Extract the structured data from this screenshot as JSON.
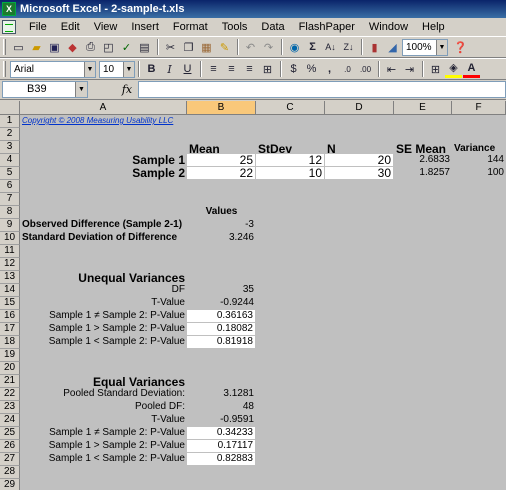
{
  "window": {
    "title": "Microsoft Excel - 2-sample-t.xls"
  },
  "menu": [
    "File",
    "Edit",
    "View",
    "Insert",
    "Format",
    "Tools",
    "Data",
    "FlashPaper",
    "Window",
    "Help"
  ],
  "toolbar": {
    "zoom": "100%",
    "font_name": "Arial",
    "font_size": "10"
  },
  "formula_bar": {
    "name_box": "B39",
    "fx": "fx",
    "formula": ""
  },
  "columns": [
    "A",
    "B",
    "C",
    "D",
    "E",
    "F"
  ],
  "active_column": "B",
  "rows": [
    "1",
    "2",
    "3",
    "4",
    "5",
    "6",
    "7",
    "8",
    "9",
    "10",
    "11",
    "12",
    "13",
    "14",
    "15",
    "16",
    "17",
    "18",
    "19",
    "20",
    "21",
    "22",
    "23",
    "24",
    "25",
    "26",
    "27",
    "28",
    "29"
  ],
  "sheet": {
    "copyright": "Copyright © 2008 Measuring Usability LLC",
    "headers": {
      "mean": "Mean",
      "stdev": "StDev",
      "n": "N",
      "se_mean": "SE Mean",
      "variance": "Variance"
    },
    "sample1": {
      "label": "Sample 1",
      "mean": "25",
      "stdev": "12",
      "n": "20",
      "se_mean": "2.6833",
      "variance": "144"
    },
    "sample2": {
      "label": "Sample 2",
      "mean": "22",
      "stdev": "10",
      "n": "30",
      "se_mean": "1.8257",
      "variance": "100"
    },
    "values_header": "Values",
    "observed_diff": {
      "label": "Observed Difference (Sample 2-1)",
      "value": "-3"
    },
    "sd_diff": {
      "label": "Standard Deviation of Difference",
      "value": "3.246"
    },
    "unequal": {
      "title": "Unequal Variances",
      "df": {
        "label": "DF",
        "value": "35"
      },
      "t": {
        "label": "T-Value",
        "value": "-0.9244"
      },
      "p_ne": {
        "label": "Sample 1 ≠ Sample 2: P-Value",
        "value": "0.36163"
      },
      "p_gt": {
        "label": "Sample 1 > Sample 2: P-Value",
        "value": "0.18082"
      },
      "p_lt": {
        "label": "Sample 1 < Sample 2: P-Value",
        "value": "0.81918"
      }
    },
    "equal": {
      "title": "Equal Variances",
      "pooled_sd": {
        "label": "Pooled Standard Deviation:",
        "value": "3.1281"
      },
      "pooled_df": {
        "label": "Pooled DF:",
        "value": "48"
      },
      "t": {
        "label": "T-Value",
        "value": "-0.9591"
      },
      "p_ne": {
        "label": "Sample 1 ≠ Sample 2: P-Value",
        "value": "0.34233"
      },
      "p_gt": {
        "label": "Sample 1 > Sample 2: P-Value",
        "value": "0.17117"
      },
      "p_lt": {
        "label": "Sample 1 < Sample 2: P-Value",
        "value": "0.82883"
      }
    }
  }
}
